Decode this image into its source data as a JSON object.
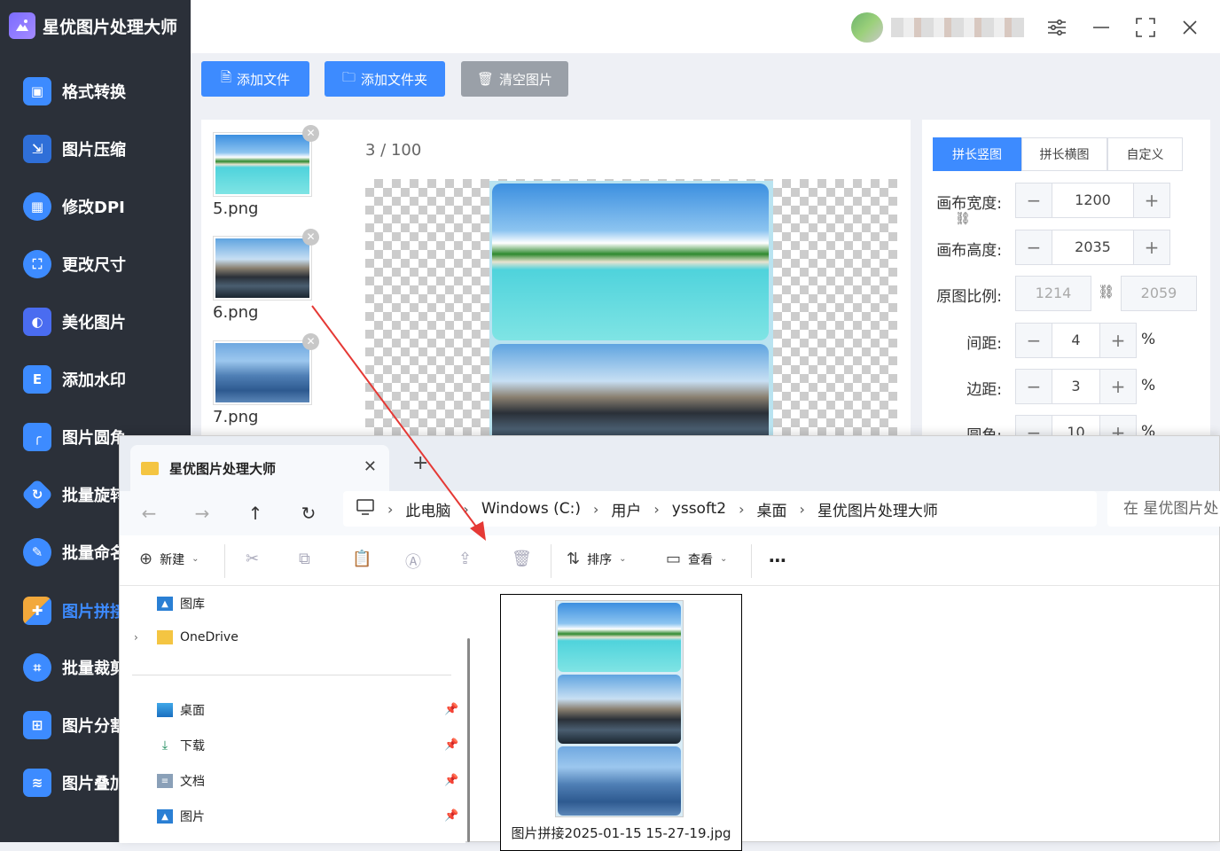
{
  "app": {
    "title": "星优图片处理大师"
  },
  "sidebar": {
    "items": [
      {
        "label": "格式转换",
        "icon": "image-convert-icon",
        "color": "#3d8bff"
      },
      {
        "label": "图片压缩",
        "icon": "compress-icon",
        "color": "#3d8bff"
      },
      {
        "label": "修改DPI",
        "icon": "dpi-icon",
        "color": "#3d8bff"
      },
      {
        "label": "更改尺寸",
        "icon": "resize-icon",
        "color": "#3d8bff"
      },
      {
        "label": "美化图片",
        "icon": "beautify-icon",
        "color": "#3d8bff"
      },
      {
        "label": "添加水印",
        "icon": "watermark-icon",
        "color": "#3d8bff"
      },
      {
        "label": "图片圆角",
        "icon": "rounded-corner-icon",
        "color": "#3d8bff"
      },
      {
        "label": "批量旋转",
        "icon": "rotate-icon",
        "color": "#3d8bff"
      },
      {
        "label": "批量命名",
        "icon": "rename-icon",
        "color": "#3d8bff"
      },
      {
        "label": "图片拼接",
        "icon": "puzzle-icon",
        "color": "#3d8bff"
      },
      {
        "label": "批量裁剪",
        "icon": "crop-icon",
        "color": "#3d8bff"
      },
      {
        "label": "图片分割",
        "icon": "split-icon",
        "color": "#3d8bff"
      },
      {
        "label": "图片叠加",
        "icon": "layers-icon",
        "color": "#3d8bff"
      }
    ]
  },
  "toolbar": {
    "add_file": "添加文件",
    "add_folder": "添加文件夹",
    "clear": "清空图片"
  },
  "thumbs": [
    {
      "name": "5.png"
    },
    {
      "name": "6.png"
    },
    {
      "name": "7.png"
    }
  ],
  "preview": {
    "page_current": "3",
    "page_sep": " / ",
    "page_total": "100"
  },
  "settings": {
    "tabs": [
      "拼长竖图",
      "拼长横图",
      "自定义"
    ],
    "canvas_width_label": "画布宽度:",
    "canvas_width": "1200",
    "canvas_height_label": "画布高度:",
    "canvas_height": "2035",
    "ratio_label": "原图比例:",
    "ratio_w": "1214",
    "ratio_h": "2059",
    "spacing_label": "间距:",
    "spacing": "4",
    "margin_label": "边距:",
    "margin": "3",
    "radius_label": "圆角:",
    "radius": "10",
    "pct": "%"
  },
  "explorer": {
    "tab_title": "星优图片处理大师",
    "breadcrumb": [
      "此电脑",
      "Windows (C:)",
      "用户",
      "yssoft2",
      "桌面",
      "星优图片处理大师"
    ],
    "search_placeholder": "在 星优图片处",
    "toolbar": {
      "new": "新建",
      "sort": "排序",
      "view": "查看"
    },
    "nav": {
      "gallery": "图库",
      "onedrive": "OneDrive",
      "desktop": "桌面",
      "downloads": "下载",
      "documents": "文档",
      "pictures": "图片"
    },
    "file": {
      "name": "图片拼接2025-01-15 15-27-19.jpg"
    }
  },
  "colors": {
    "accent": "#3d8bff",
    "sidebar_bg": "#2b3039",
    "arrow": "#e53935"
  }
}
